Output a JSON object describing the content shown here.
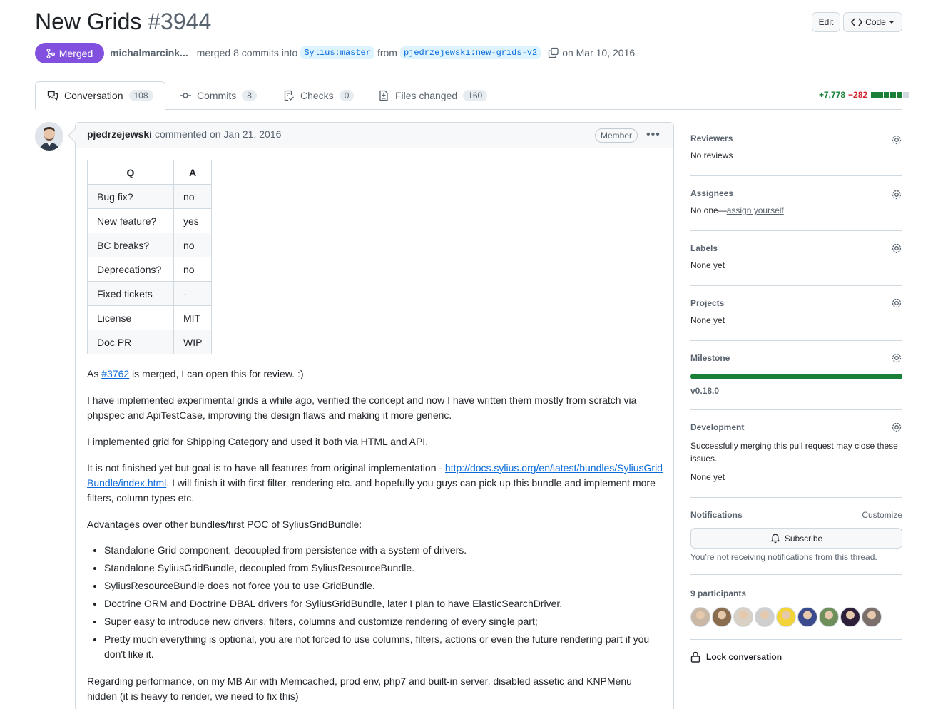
{
  "pr": {
    "title": "New Grids",
    "number": "#3944",
    "status": "Merged",
    "author": "michalmarcink...",
    "merged_text": "merged 8 commits into",
    "base_branch": "Sylius:master",
    "from_text": "from",
    "head_branch": "pjedrzejewski:new-grids-v2",
    "date_text": "on Mar 10, 2016"
  },
  "header_buttons": {
    "edit": "Edit",
    "code": "Code"
  },
  "tabs": [
    {
      "label": "Conversation",
      "count": "108",
      "icon": "comment-discussion-icon"
    },
    {
      "label": "Commits",
      "count": "8",
      "icon": "git-commit-icon"
    },
    {
      "label": "Checks",
      "count": "0",
      "icon": "checklist-icon"
    },
    {
      "label": "Files changed",
      "count": "160",
      "icon": "file-diff-icon"
    }
  ],
  "diffstat": {
    "additions": "+7,778",
    "deletions": "−282"
  },
  "comment": {
    "author": "pjedrzejewski",
    "action": "commented on Jan 21, 2016",
    "role": "Member",
    "table": {
      "headers": [
        "Q",
        "A"
      ],
      "rows": [
        [
          "Bug fix?",
          "no"
        ],
        [
          "New feature?",
          "yes"
        ],
        [
          "BC breaks?",
          "no"
        ],
        [
          "Deprecations?",
          "no"
        ],
        [
          "Fixed tickets",
          "-"
        ],
        [
          "License",
          "MIT"
        ],
        [
          "Doc PR",
          "WIP"
        ]
      ]
    },
    "p1_pre": "As ",
    "p1_link": "#3762",
    "p1_post": " is merged, I can open this for review. :)",
    "p2": "I have implemented experimental grids a while ago, verified the concept and now I have written them mostly from scratch via phpspec and ApiTestCase, improving the design flaws and making it more generic.",
    "p3": "I implemented grid for Shipping Category and used it both via HTML and API.",
    "p4_pre": "It is not finished yet but goal is to have all features from original implementation - ",
    "p4_link": "http://docs.sylius.org/en/latest/bundles/SyliusGridBundle/index.html",
    "p4_post": ". I will finish it with first filter, rendering etc. and hopefully you guys can pick up this bundle and implement more filters, column types etc.",
    "p5": "Advantages over other bundles/first POC of SyliusGridBundle:",
    "bullets": [
      "Standalone Grid component, decoupled from persistence with a system of drivers.",
      "Standalone SyliusGridBundle, decoupled from SyliusResourceBundle.",
      "SyliusResourceBundle does not force you to use GridBundle.",
      "Doctrine ORM and Doctrine DBAL drivers for SyliusGridBundle, later I plan to have ElasticSearchDriver.",
      "Super easy to introduce new drivers, filters, columns and customize rendering of every single part;",
      "Pretty much everything is optional, you are not forced to use columns, filters, actions or even the future rendering part if you don't like it."
    ],
    "p6": "Regarding performance, on my MB Air with Memcached, prod env, php7 and built-in server, disabled assetic and KNPMenu hidden (it is heavy to render, we need to fix this)"
  },
  "sidebar": {
    "reviewers": {
      "title": "Reviewers",
      "value": "No reviews"
    },
    "assignees": {
      "title": "Assignees",
      "value": "No one—",
      "link": "assign yourself"
    },
    "labels": {
      "title": "Labels",
      "value": "None yet"
    },
    "projects": {
      "title": "Projects",
      "value": "None yet"
    },
    "milestone": {
      "title": "Milestone",
      "value": "v0.18.0",
      "progress": 1.0
    },
    "development": {
      "title": "Development",
      "desc": "Successfully merging this pull request may close these issues.",
      "value": "None yet"
    },
    "notifications": {
      "title": "Notifications",
      "customize": "Customize",
      "button": "Subscribe",
      "note": "You’re not receiving notifications from this thread."
    },
    "participants": {
      "title": "9 participants",
      "colors": [
        "#c9b8a6",
        "#8a6d4f",
        "#d9d0c6",
        "#cfcfcf",
        "#f2d43a",
        "#3a4a8c",
        "#6e8f5a",
        "#2d1f3a",
        "#7a6f6a"
      ]
    },
    "lock": "Lock conversation"
  },
  "colors": {
    "merged": "#8250df",
    "link": "#0969da",
    "add": "#1a7f37",
    "del": "#d1242f"
  }
}
